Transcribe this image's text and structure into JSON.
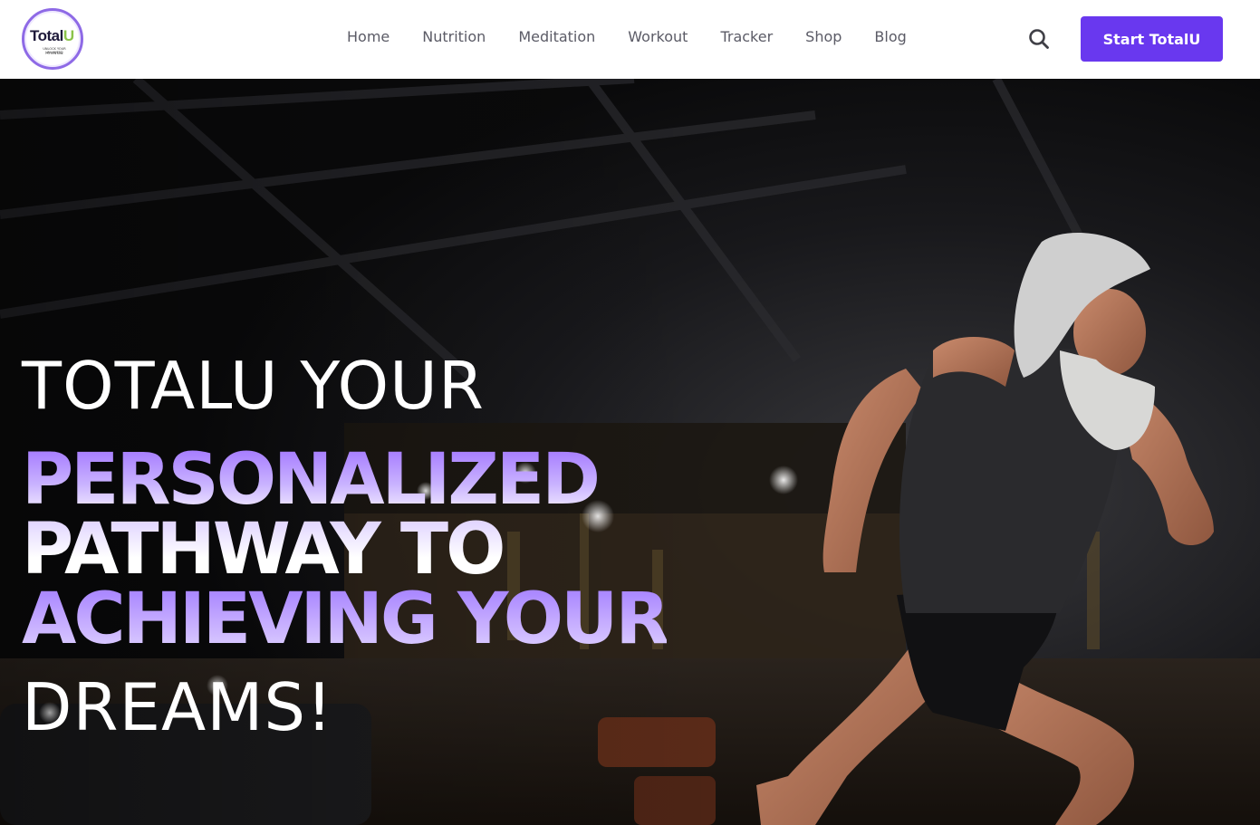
{
  "header": {
    "logo": {
      "word_main": "Total",
      "word_accent": "U",
      "tagline_1": "UNLOCK YOUR UNLIMITED",
      "tagline_2": "POTENTIAL"
    },
    "nav": [
      {
        "label": "Home"
      },
      {
        "label": "Nutrition"
      },
      {
        "label": "Meditation"
      },
      {
        "label": "Workout"
      },
      {
        "label": "Tracker"
      },
      {
        "label": "Shop"
      },
      {
        "label": "Blog"
      }
    ],
    "search_icon": "search-icon",
    "cta_label": "Start TotalU"
  },
  "hero": {
    "line1": "TOTALU YOUR",
    "line2": "PERSONALIZED",
    "line3": "PATHWAY TO",
    "line4": "ACHIEVING YOUR",
    "line5": "DREAMS!"
  },
  "colors": {
    "brand_purple": "#6938ef",
    "accent_lavender": "#a07bff",
    "logo_green": "#8bc34a",
    "nav_text": "#5b5b66"
  }
}
